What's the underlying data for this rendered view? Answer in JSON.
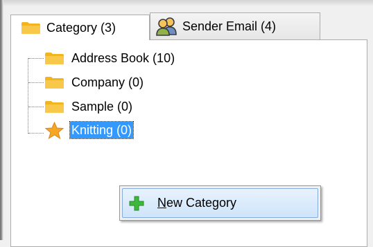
{
  "tabs": [
    {
      "label": "Category (3)",
      "icon": "folder-icon",
      "active": true
    },
    {
      "label": "Sender Email (4)",
      "icon": "users-icon",
      "active": false
    }
  ],
  "tree": {
    "items": [
      {
        "label": "Address Book (10)",
        "icon": "folder-icon",
        "selected": false
      },
      {
        "label": "Company (0)",
        "icon": "folder-icon",
        "selected": false
      },
      {
        "label": "Sample (0)",
        "icon": "folder-icon",
        "selected": false
      },
      {
        "label": "Knitting (0)",
        "icon": "star-icon",
        "selected": true
      }
    ]
  },
  "context_menu": {
    "items": [
      {
        "mnemonic": "N",
        "rest": "ew Category",
        "icon": "plus-icon"
      }
    ]
  },
  "colors": {
    "selection": "#3399ff",
    "folder": "#f2b51f",
    "star": "#f5a623",
    "plus": "#3cb83c",
    "menu_highlight": "#cfe4fa"
  }
}
